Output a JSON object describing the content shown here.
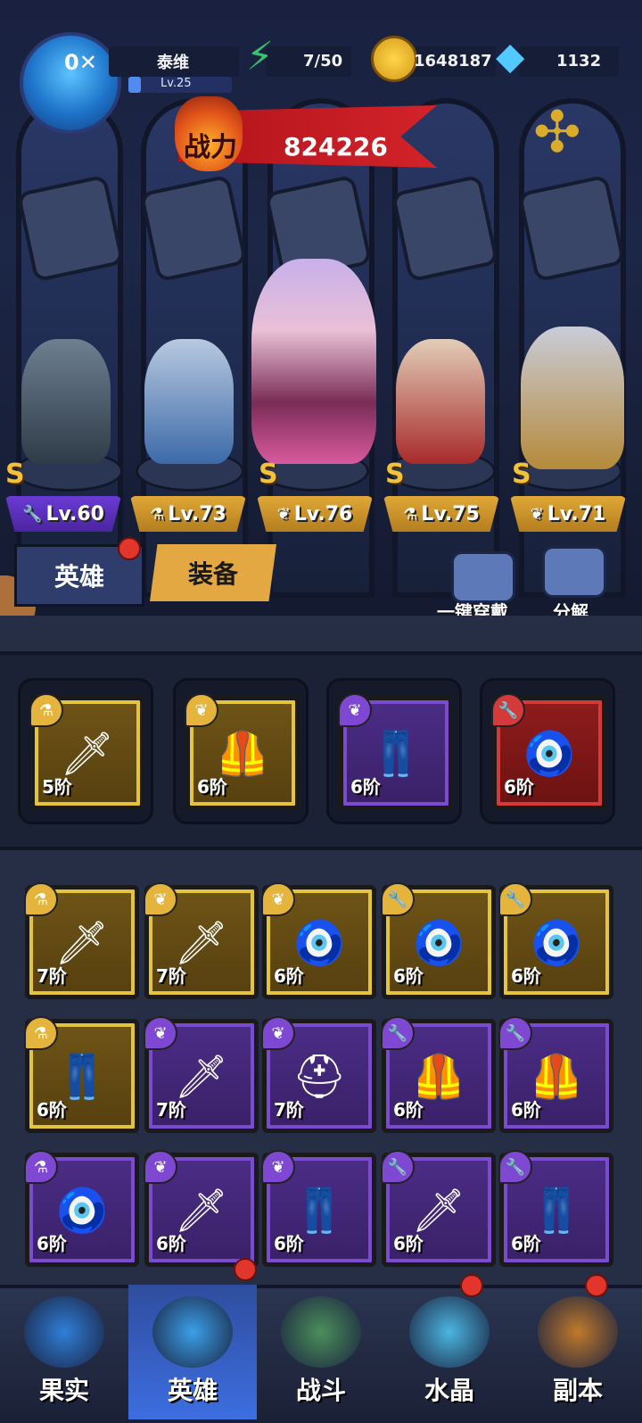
{
  "player": {
    "name": "泰维",
    "level": "Lv.25",
    "avatar_badge": "0✕"
  },
  "resources": {
    "stamina": "7/50",
    "gold": "1648187",
    "diamonds": "1132"
  },
  "power": {
    "label": "战力",
    "value": "824226"
  },
  "heroes": [
    {
      "rank": "S",
      "level": "Lv.60",
      "color": "#5a32c0"
    },
    {
      "rank": "",
      "level": "Lv.73",
      "color": "#d29a2e"
    },
    {
      "rank": "S",
      "level": "Lv.76",
      "color": "#d29a2e"
    },
    {
      "rank": "S",
      "level": "Lv.75",
      "color": "#d29a2e"
    },
    {
      "rank": "S",
      "level": "Lv.71",
      "color": "#d29a2e"
    }
  ],
  "tabs": {
    "hero": "英雄",
    "equipment": "装备"
  },
  "actions": {
    "equip_all": "一键穿戴",
    "decompose": "分解"
  },
  "equipped": [
    {
      "tier": "5阶",
      "quality": "gold",
      "icon": "sword-icon"
    },
    {
      "tier": "6阶",
      "quality": "gold",
      "icon": "armor-icon"
    },
    {
      "tier": "6阶",
      "quality": "purple",
      "icon": "pants-icon"
    },
    {
      "tier": "6阶",
      "quality": "red",
      "icon": "amulet-icon"
    }
  ],
  "inventory": [
    {
      "tier": "7阶",
      "quality": "gold",
      "icon": "sword-icon"
    },
    {
      "tier": "7阶",
      "quality": "gold",
      "icon": "sword-icon"
    },
    {
      "tier": "6阶",
      "quality": "gold",
      "icon": "amulet-icon"
    },
    {
      "tier": "6阶",
      "quality": "gold",
      "icon": "amulet-icon"
    },
    {
      "tier": "6阶",
      "quality": "gold",
      "icon": "amulet-icon"
    },
    {
      "tier": "6阶",
      "quality": "gold",
      "icon": "pants-icon"
    },
    {
      "tier": "7阶",
      "quality": "purple",
      "icon": "sword-icon"
    },
    {
      "tier": "7阶",
      "quality": "purple",
      "icon": "helmet-icon"
    },
    {
      "tier": "6阶",
      "quality": "purple",
      "icon": "armor-icon"
    },
    {
      "tier": "6阶",
      "quality": "purple",
      "icon": "armor-icon"
    },
    {
      "tier": "6阶",
      "quality": "purple",
      "icon": "amulet-icon"
    },
    {
      "tier": "6阶",
      "quality": "purple",
      "icon": "sword-icon"
    },
    {
      "tier": "6阶",
      "quality": "purple",
      "icon": "pants-icon"
    },
    {
      "tier": "6阶",
      "quality": "purple",
      "icon": "sword-icon"
    },
    {
      "tier": "6阶",
      "quality": "purple",
      "icon": "pants-icon"
    }
  ],
  "nav": [
    {
      "label": "果实",
      "icon": "fruit-icon"
    },
    {
      "label": "英雄",
      "icon": "hero-hat-icon"
    },
    {
      "label": "战斗",
      "icon": "battle-sword-icon"
    },
    {
      "label": "水晶",
      "icon": "crystal-icon"
    },
    {
      "label": "副本",
      "icon": "dungeon-portal-icon"
    }
  ]
}
